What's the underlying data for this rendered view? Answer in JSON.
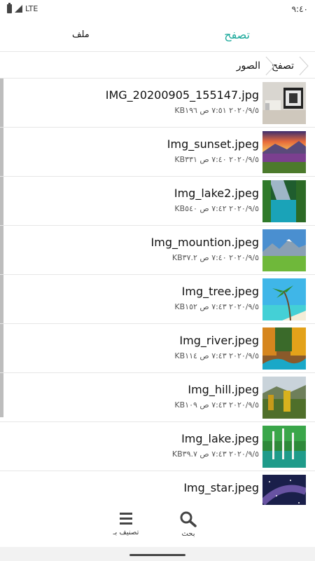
{
  "status_bar": {
    "network": "LTE",
    "time": "٩:٤٠"
  },
  "tabs": {
    "browse": "تصفح",
    "file": "ملف"
  },
  "breadcrumb": {
    "root": "تصفح",
    "folder": "الصور"
  },
  "files": [
    {
      "name": "IMG_20200905_155147.jpg",
      "meta": "٢٠٢٠/٩/٥ ٧:٥١ ص KB١٩٦"
    },
    {
      "name": "Img_sunset.jpeg",
      "meta": "٢٠٢٠/٩/٥ ٧:٤٠ ص KB٣٣١"
    },
    {
      "name": "Img_lake2.jpeg",
      "meta": "٢٠٢٠/٩/٥ ٧:٤٢ ص KB٥٤٠"
    },
    {
      "name": "Img_mountion.jpeg",
      "meta": "٢٠٢٠/٩/٥ ٧:٤٠ ص KB٣٧.٢"
    },
    {
      "name": "Img_tree.jpeg",
      "meta": "٢٠٢٠/٩/٥ ٧:٤٣ ص KB١٥٢"
    },
    {
      "name": "Img_river.jpeg",
      "meta": "٢٠٢٠/٩/٥ ٧:٤٣ ص KB١١٤"
    },
    {
      "name": "Img_hill.jpeg",
      "meta": "٢٠٢٠/٩/٥ ٧:٤٣ ص KB١٠٩"
    },
    {
      "name": "Img_lake.jpeg",
      "meta": "٢٠٢٠/٩/٥ ٧:٤٣ ص KB٣٩.٧"
    },
    {
      "name": "Img_star.jpeg",
      "meta": ""
    }
  ],
  "bottom_bar": {
    "sort_label": "تصنيف بـ",
    "search_label": "بحث"
  },
  "colors": {
    "accent": "#19a89a"
  },
  "icons": [
    "battery-icon",
    "signal-icon",
    "chevron-icon",
    "menu-icon",
    "search-icon"
  ]
}
